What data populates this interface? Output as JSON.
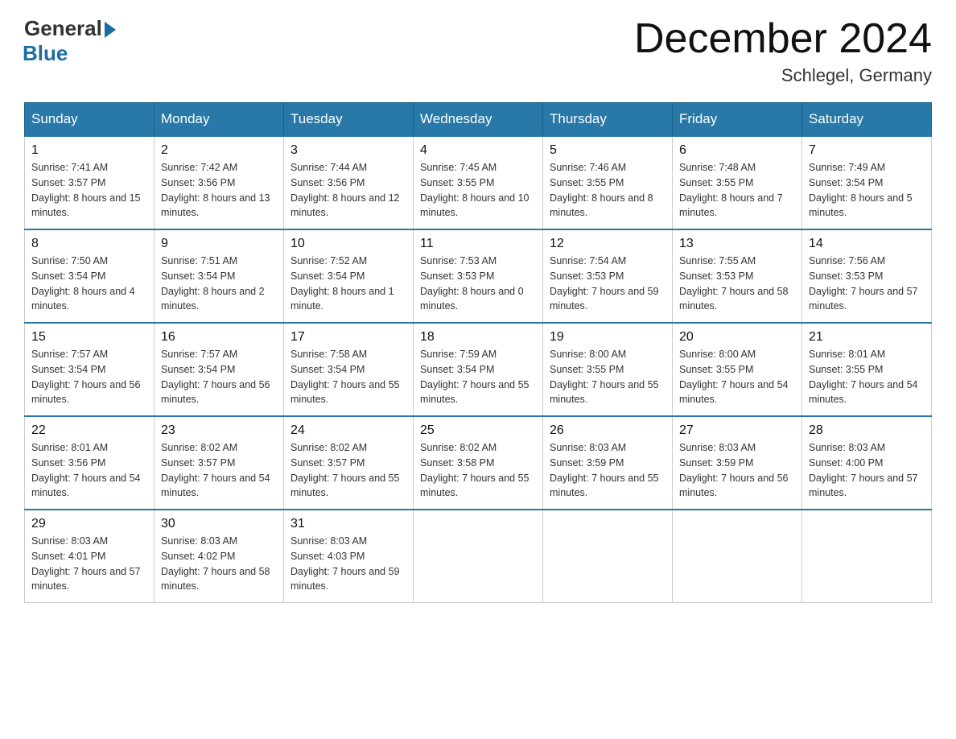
{
  "header": {
    "logo_general": "General",
    "logo_blue": "Blue",
    "month_title": "December 2024",
    "location": "Schlegel, Germany"
  },
  "weekdays": [
    "Sunday",
    "Monday",
    "Tuesday",
    "Wednesday",
    "Thursday",
    "Friday",
    "Saturday"
  ],
  "weeks": [
    [
      {
        "day": "1",
        "sunrise": "7:41 AM",
        "sunset": "3:57 PM",
        "daylight": "8 hours and 15 minutes."
      },
      {
        "day": "2",
        "sunrise": "7:42 AM",
        "sunset": "3:56 PM",
        "daylight": "8 hours and 13 minutes."
      },
      {
        "day": "3",
        "sunrise": "7:44 AM",
        "sunset": "3:56 PM",
        "daylight": "8 hours and 12 minutes."
      },
      {
        "day": "4",
        "sunrise": "7:45 AM",
        "sunset": "3:55 PM",
        "daylight": "8 hours and 10 minutes."
      },
      {
        "day": "5",
        "sunrise": "7:46 AM",
        "sunset": "3:55 PM",
        "daylight": "8 hours and 8 minutes."
      },
      {
        "day": "6",
        "sunrise": "7:48 AM",
        "sunset": "3:55 PM",
        "daylight": "8 hours and 7 minutes."
      },
      {
        "day": "7",
        "sunrise": "7:49 AM",
        "sunset": "3:54 PM",
        "daylight": "8 hours and 5 minutes."
      }
    ],
    [
      {
        "day": "8",
        "sunrise": "7:50 AM",
        "sunset": "3:54 PM",
        "daylight": "8 hours and 4 minutes."
      },
      {
        "day": "9",
        "sunrise": "7:51 AM",
        "sunset": "3:54 PM",
        "daylight": "8 hours and 2 minutes."
      },
      {
        "day": "10",
        "sunrise": "7:52 AM",
        "sunset": "3:54 PM",
        "daylight": "8 hours and 1 minute."
      },
      {
        "day": "11",
        "sunrise": "7:53 AM",
        "sunset": "3:53 PM",
        "daylight": "8 hours and 0 minutes."
      },
      {
        "day": "12",
        "sunrise": "7:54 AM",
        "sunset": "3:53 PM",
        "daylight": "7 hours and 59 minutes."
      },
      {
        "day": "13",
        "sunrise": "7:55 AM",
        "sunset": "3:53 PM",
        "daylight": "7 hours and 58 minutes."
      },
      {
        "day": "14",
        "sunrise": "7:56 AM",
        "sunset": "3:53 PM",
        "daylight": "7 hours and 57 minutes."
      }
    ],
    [
      {
        "day": "15",
        "sunrise": "7:57 AM",
        "sunset": "3:54 PM",
        "daylight": "7 hours and 56 minutes."
      },
      {
        "day": "16",
        "sunrise": "7:57 AM",
        "sunset": "3:54 PM",
        "daylight": "7 hours and 56 minutes."
      },
      {
        "day": "17",
        "sunrise": "7:58 AM",
        "sunset": "3:54 PM",
        "daylight": "7 hours and 55 minutes."
      },
      {
        "day": "18",
        "sunrise": "7:59 AM",
        "sunset": "3:54 PM",
        "daylight": "7 hours and 55 minutes."
      },
      {
        "day": "19",
        "sunrise": "8:00 AM",
        "sunset": "3:55 PM",
        "daylight": "7 hours and 55 minutes."
      },
      {
        "day": "20",
        "sunrise": "8:00 AM",
        "sunset": "3:55 PM",
        "daylight": "7 hours and 54 minutes."
      },
      {
        "day": "21",
        "sunrise": "8:01 AM",
        "sunset": "3:55 PM",
        "daylight": "7 hours and 54 minutes."
      }
    ],
    [
      {
        "day": "22",
        "sunrise": "8:01 AM",
        "sunset": "3:56 PM",
        "daylight": "7 hours and 54 minutes."
      },
      {
        "day": "23",
        "sunrise": "8:02 AM",
        "sunset": "3:57 PM",
        "daylight": "7 hours and 54 minutes."
      },
      {
        "day": "24",
        "sunrise": "8:02 AM",
        "sunset": "3:57 PM",
        "daylight": "7 hours and 55 minutes."
      },
      {
        "day": "25",
        "sunrise": "8:02 AM",
        "sunset": "3:58 PM",
        "daylight": "7 hours and 55 minutes."
      },
      {
        "day": "26",
        "sunrise": "8:03 AM",
        "sunset": "3:59 PM",
        "daylight": "7 hours and 55 minutes."
      },
      {
        "day": "27",
        "sunrise": "8:03 AM",
        "sunset": "3:59 PM",
        "daylight": "7 hours and 56 minutes."
      },
      {
        "day": "28",
        "sunrise": "8:03 AM",
        "sunset": "4:00 PM",
        "daylight": "7 hours and 57 minutes."
      }
    ],
    [
      {
        "day": "29",
        "sunrise": "8:03 AM",
        "sunset": "4:01 PM",
        "daylight": "7 hours and 57 minutes."
      },
      {
        "day": "30",
        "sunrise": "8:03 AM",
        "sunset": "4:02 PM",
        "daylight": "7 hours and 58 minutes."
      },
      {
        "day": "31",
        "sunrise": "8:03 AM",
        "sunset": "4:03 PM",
        "daylight": "7 hours and 59 minutes."
      },
      null,
      null,
      null,
      null
    ]
  ]
}
